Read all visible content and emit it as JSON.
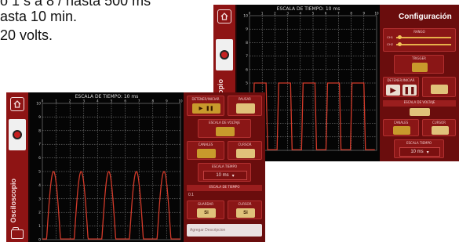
{
  "background_text": {
    "line1": "o 1 s a 8 / hasta 500 ms",
    "line2": "asta 10 min.",
    "line3": "20 volts."
  },
  "left_screen": {
    "sidebar_label": "Osciloscopio",
    "scope_title": "ESCALA DE TIEMPO: 10 ms",
    "y_ticks": [
      "10",
      "9",
      "8",
      "7",
      "6",
      "5",
      "4",
      "3",
      "2",
      "1",
      "0"
    ],
    "x_ticks": [
      "0",
      "1",
      "2",
      "3",
      "4",
      "5",
      "6",
      "7",
      "8",
      "9",
      "10"
    ],
    "controls": {
      "run_stop_label": "DETENER/INICIAR",
      "pause_label": "PAUSAR",
      "volt_scale_label": "ESCALA DE VOLTAJE",
      "channel_label": "CANALES",
      "cursor_label": "CURSOR",
      "time_scale_label": "ESCALA TIEMPO",
      "time_select_value": "10 ms",
      "time_scale_strip": "ESCALA DE TIEMPO",
      "volt_value": "0.1",
      "save_label": "GUARDAR",
      "cursor_switch_label": "CURSOR",
      "save_value": "Si",
      "cursor_value": "Si",
      "input_placeholder": "Agregar Descripcion"
    },
    "signal_color": "#d23a2a"
  },
  "right_screen": {
    "sidebar_label": "Osciloscopio",
    "scope_title": "ESCALA DE TIEMPO: 10 ms",
    "config_title": "Configuración",
    "controls": {
      "range_label": "RANGO",
      "canal1_label": "CH1",
      "canal2_label": "CH2",
      "trigger_label": "TRIGGER",
      "run_stop_label": "DETENER/INICIAR",
      "volt_scale_label": "ESCALA DE VOLTAJE",
      "channel_label": "CANALES",
      "cursor_label": "CURSOR",
      "time_scale_label": "ESCALA TIEMPO",
      "time_select_value": "10 ms"
    },
    "signal_color": "#d23a2a"
  },
  "colors": {
    "sidebar": "#8e1414",
    "panel": "#6a0d0d",
    "accent": "#c89a2c",
    "screen_bg": "#050505"
  }
}
